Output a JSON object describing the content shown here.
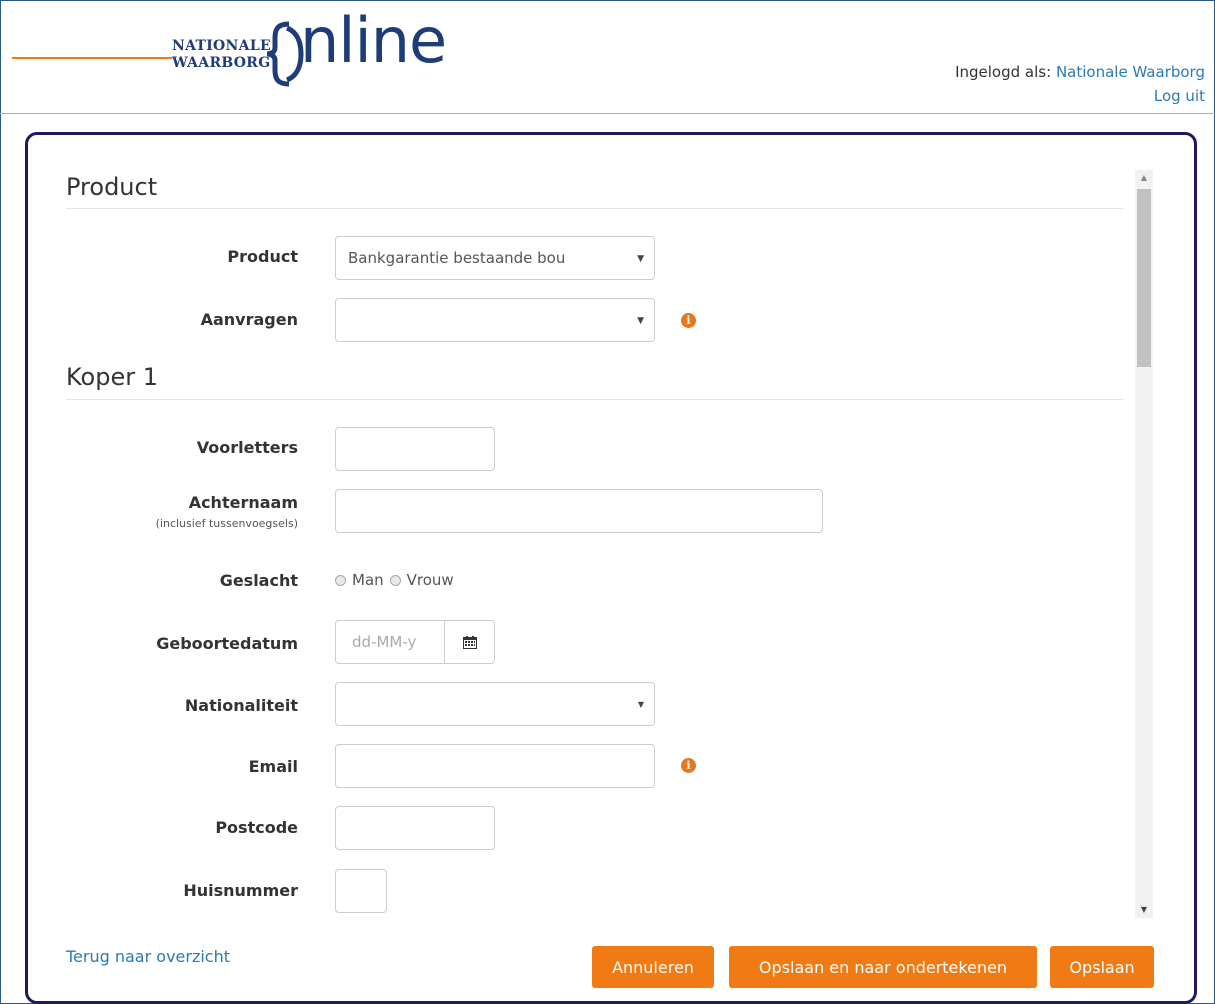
{
  "brand": {
    "logo_line1": "NATIONALE",
    "logo_line2": "WAARBORG",
    "logo_online": "nline",
    "accent": "#f07b14",
    "navy": "#1d3c78"
  },
  "header": {
    "logged_in_prefix": "Ingelogd als:",
    "user_name": "Nationale Waarborg",
    "logout": "Log uit"
  },
  "sections": {
    "product": "Product",
    "koper": "Koper 1"
  },
  "form": {
    "product_label": "Product",
    "product_value": "Bankgarantie bestaande bou",
    "aanvragen_label": "Aanvragen",
    "aanvragen_value": "",
    "voorletters_label": "Voorletters",
    "achternaam_label": "Achternaam",
    "achternaam_sub": "(inclusief tussenvoegsels)",
    "geslacht_label": "Geslacht",
    "geslacht_options": [
      "Man",
      "Vrouw"
    ],
    "geboortedatum_label": "Geboortedatum",
    "geboortedatum_placeholder": "dd-MM-y",
    "nationaliteit_label": "Nationaliteit",
    "email_label": "Email",
    "postcode_label": "Postcode",
    "huisnummer_label": "Huisnummer",
    "info_glyph": "i",
    "select_arrow": "▼",
    "calendar_icon": "calendar-icon"
  },
  "footer": {
    "back_link": "Terug naar overzicht",
    "cancel": "Annuleren",
    "save_sign": "Opslaan en naar ondertekenen",
    "save": "Opslaan"
  },
  "scrollbar": {
    "up": "▲",
    "down": "▼"
  }
}
